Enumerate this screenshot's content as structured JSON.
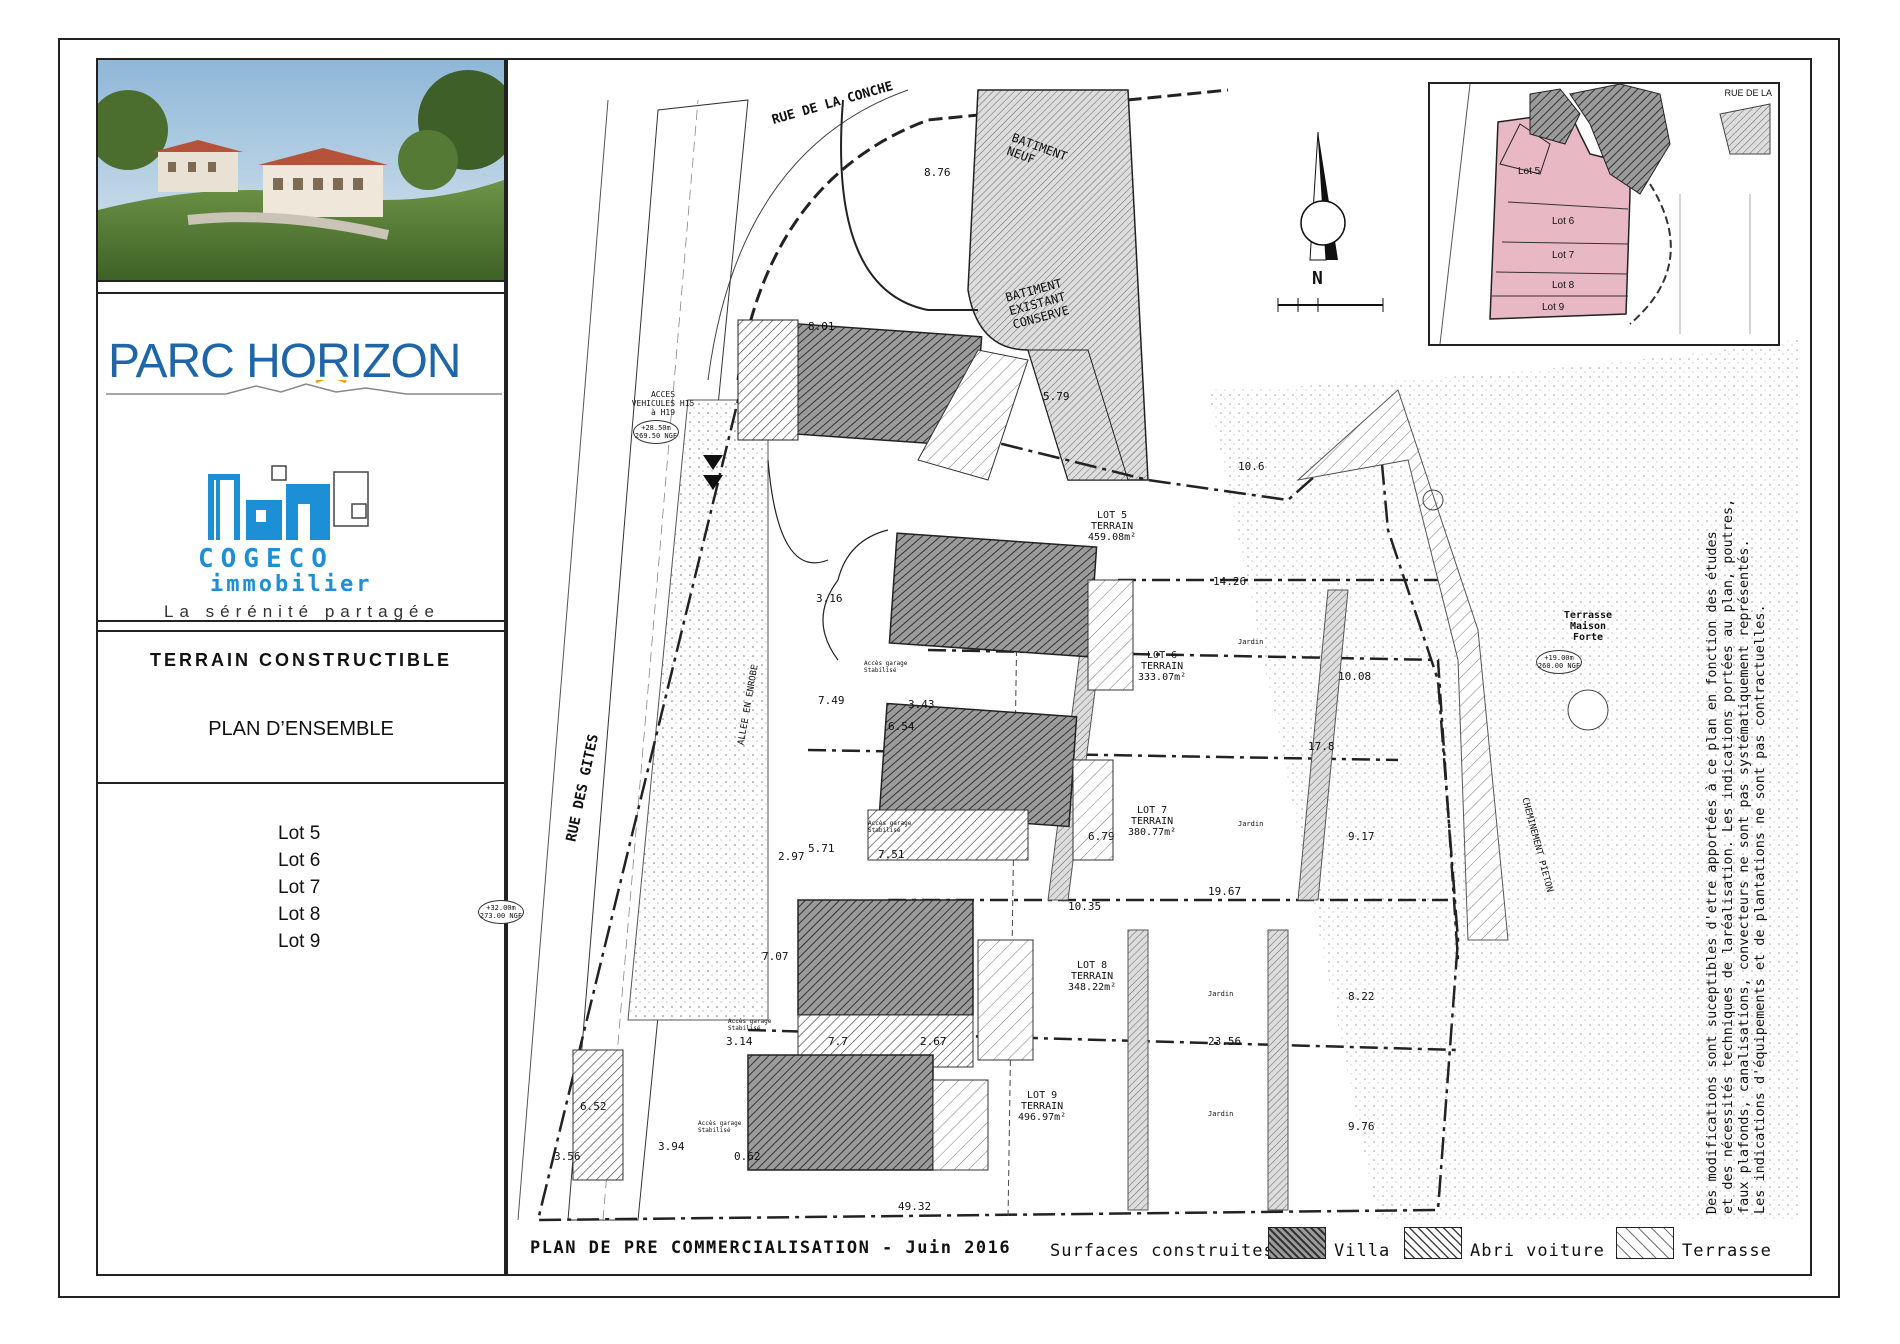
{
  "sidebar": {
    "brand_name": "PARC HORIZON",
    "company_name": "COGECO",
    "company_sub": "immobilier",
    "slogan": "La sérénité partagée",
    "doc_type": "TERRAIN CONSTRUCTIBLE",
    "doc_title": "PLAN D’ENSEMBLE",
    "lots": [
      "Lot 5",
      "Lot 6",
      "Lot 7",
      "Lot 8",
      "Lot 9"
    ]
  },
  "plan": {
    "footer_title": "PLAN DE PRE COMMERCIALISATION - Juin 2016",
    "legend_title": "Surfaces construites:",
    "legend": [
      {
        "label": "Villa",
        "pattern": "dense"
      },
      {
        "label": "Abri voiture",
        "pattern": "medium"
      },
      {
        "label": "Terrasse",
        "pattern": "light"
      }
    ],
    "streets": {
      "top": "RUE DE LA CONCHE",
      "left": "RUE DES GITES"
    },
    "buildings": {
      "new": "BATIMENT NEUF",
      "existing": "BATIMENT EXISTANT CONSERVE"
    },
    "access_label": "ACCES VEHICULES H15 à H19",
    "alley_label": "ALLEE EN ENROBE",
    "path_label": "CHEMINEMENT PIETON",
    "terrace_label": "Terrasse Maison Forte",
    "garden_label": "Jardin",
    "parking_label": "Accès garage Stabilisé",
    "lots": [
      {
        "name": "LOT 5",
        "type": "TERRAIN",
        "area": "459.08m²"
      },
      {
        "name": "LOT 6",
        "type": "TERRAIN",
        "area": "333.07m²"
      },
      {
        "name": "LOT 7",
        "type": "TERRAIN",
        "area": "380.77m²"
      },
      {
        "name": "LOT 8",
        "type": "TERRAIN",
        "area": "348.22m²"
      },
      {
        "name": "LOT 9",
        "type": "TERRAIN",
        "area": "496.97m²"
      }
    ],
    "dimensions": [
      "14.26",
      "17.8",
      "19.67",
      "23.56",
      "49.32",
      "10.08",
      "9.17",
      "8.22",
      "9.76",
      "10.35",
      "6.79",
      "7.49",
      "5.71",
      "7.51",
      "3.94",
      "3.14",
      "7.7",
      "2.67",
      "3.43",
      "8.01",
      "5.79",
      "3.16",
      "6.54",
      "2.97",
      "7.07",
      "6.52",
      "3.56",
      "0.62",
      "8.76",
      "10.6"
    ],
    "levels": [
      "+28.50m 269.50 NGF",
      "+32.00m 273.00 NGF",
      "+19.00m 260.00 NGF"
    ],
    "north": "N",
    "note": [
      "Des modifications sont suceptibles d'etre apportées à ce plan en fonction des études",
      "et des nécessités techniques de laréalisation. Les indications portées au plan, poutres,",
      "faux plafonds, canalisations, convecteurs ne sont pas systématiquement représentés.",
      "Les indications d'équipements et de plantations ne sont pas contractuelles."
    ],
    "inset_lots": [
      "Lot 5",
      "Lot 6",
      "Lot 7",
      "Lot 8",
      "Lot 9"
    ],
    "inset_street": "RUE DE LA"
  },
  "colors": {
    "brand_blue": "#1f66a8",
    "cogeco_blue": "#1d8fd6",
    "inset_pink": "#e8b8c4"
  }
}
